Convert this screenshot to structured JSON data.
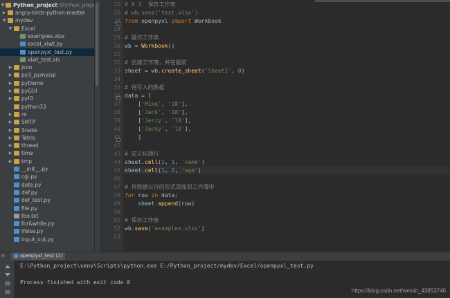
{
  "project": {
    "root_name": "Python_project",
    "root_path": "E:\\Python_project",
    "items": [
      {
        "label": "angry-birds-python-master",
        "type": "folder",
        "arrow": "▶"
      },
      {
        "label": "mydev",
        "type": "folder",
        "arrow": "▼"
      },
      {
        "label": "Excel",
        "type": "folder",
        "arrow": "▼"
      },
      {
        "label": "examples.xlsx",
        "type": "xlsx",
        "arrow": ""
      },
      {
        "label": "excel_xlwt.py",
        "type": "py",
        "arrow": ""
      },
      {
        "label": "openpyxl_test.py",
        "type": "py",
        "arrow": "",
        "selected": true
      },
      {
        "label": "xlwt_test.xls",
        "type": "xlsx",
        "arrow": ""
      },
      {
        "label": "json",
        "type": "folder",
        "arrow": "▶"
      },
      {
        "label": "py3_pymysql",
        "type": "folder",
        "arrow": "▶"
      },
      {
        "label": "pyDemo",
        "type": "folder",
        "arrow": "▶"
      },
      {
        "label": "pyGUI",
        "type": "folder",
        "arrow": "▶"
      },
      {
        "label": "pyIO",
        "type": "folder",
        "arrow": "▶"
      },
      {
        "label": "python33",
        "type": "folder",
        "arrow": ""
      },
      {
        "label": "re",
        "type": "folder",
        "arrow": "▶"
      },
      {
        "label": "SMTP",
        "type": "folder",
        "arrow": "▶"
      },
      {
        "label": "Snake",
        "type": "folder",
        "arrow": "▶"
      },
      {
        "label": "Tetris",
        "type": "folder",
        "arrow": "▶"
      },
      {
        "label": "thread",
        "type": "folder",
        "arrow": "▶"
      },
      {
        "label": "time",
        "type": "folder",
        "arrow": "▶"
      },
      {
        "label": "tmp",
        "type": "folder",
        "arrow": "▶"
      },
      {
        "label": "__init__.py",
        "type": "py",
        "arrow": ""
      },
      {
        "label": "cgi.py",
        "type": "py",
        "arrow": ""
      },
      {
        "label": "date.py",
        "type": "py",
        "arrow": ""
      },
      {
        "label": "def.py",
        "type": "py",
        "arrow": ""
      },
      {
        "label": "def_test.py",
        "type": "py",
        "arrow": ""
      },
      {
        "label": "file.py",
        "type": "py",
        "arrow": ""
      },
      {
        "label": "foo.txt",
        "type": "txt",
        "arrow": ""
      },
      {
        "label": "for&while.py",
        "type": "py",
        "arrow": ""
      },
      {
        "label": "ifelse.py",
        "type": "py",
        "arrow": ""
      },
      {
        "label": "input_out.py",
        "type": "py",
        "arrow": ""
      }
    ]
  },
  "editor": {
    "line_numbers": [
      "25",
      "26",
      "27",
      "28",
      "29",
      "30",
      "31",
      "32",
      "33",
      "34",
      "35",
      "36",
      "37",
      "38",
      "39",
      "40",
      "41",
      "42",
      "43",
      "44",
      "45",
      "46",
      "47",
      "48",
      "49",
      "50",
      "51",
      "52",
      "53"
    ],
    "lines": [
      "# # 3. 保存工作表",
      "# wb.save('test.xlsx')",
      "from openpyxl import Workbook",
      "",
      "# 操作工作表",
      "wb = Workbook()",
      "",
      "# 创建工作簿，并在最前",
      "sheet = wb.create_sheet('Sheet1', 0)",
      "",
      "# 待写入的数据",
      "data = [",
      "    ['Mike', '18'],",
      "    ['Jack', '18'],",
      "    ['Jerry', '18'],",
      "    ['Jacky', '18'],",
      "    ]",
      "",
      "# 定义标题行",
      "sheet.cell(1, 1, 'name')",
      "sheet.cell(1, 2, 'age')",
      "",
      "# 将数据以行的形式添加到工作薄中",
      "for row in data:",
      "    sheet.append(row)",
      "",
      "# 保存工作表",
      "wb.save('examples.xlsx')",
      ""
    ]
  },
  "run": {
    "panel_label": "n:",
    "tab_label": "openpyxl_test (1)",
    "command": "E:\\Python_project\\venv\\Scripts\\python.exe E:/Python_project/mydev/Excel/openpyxl_test.py",
    "result": "Process finished with exit code 0"
  },
  "watermark": "https://blog.csdn.net/weixin_43853746"
}
